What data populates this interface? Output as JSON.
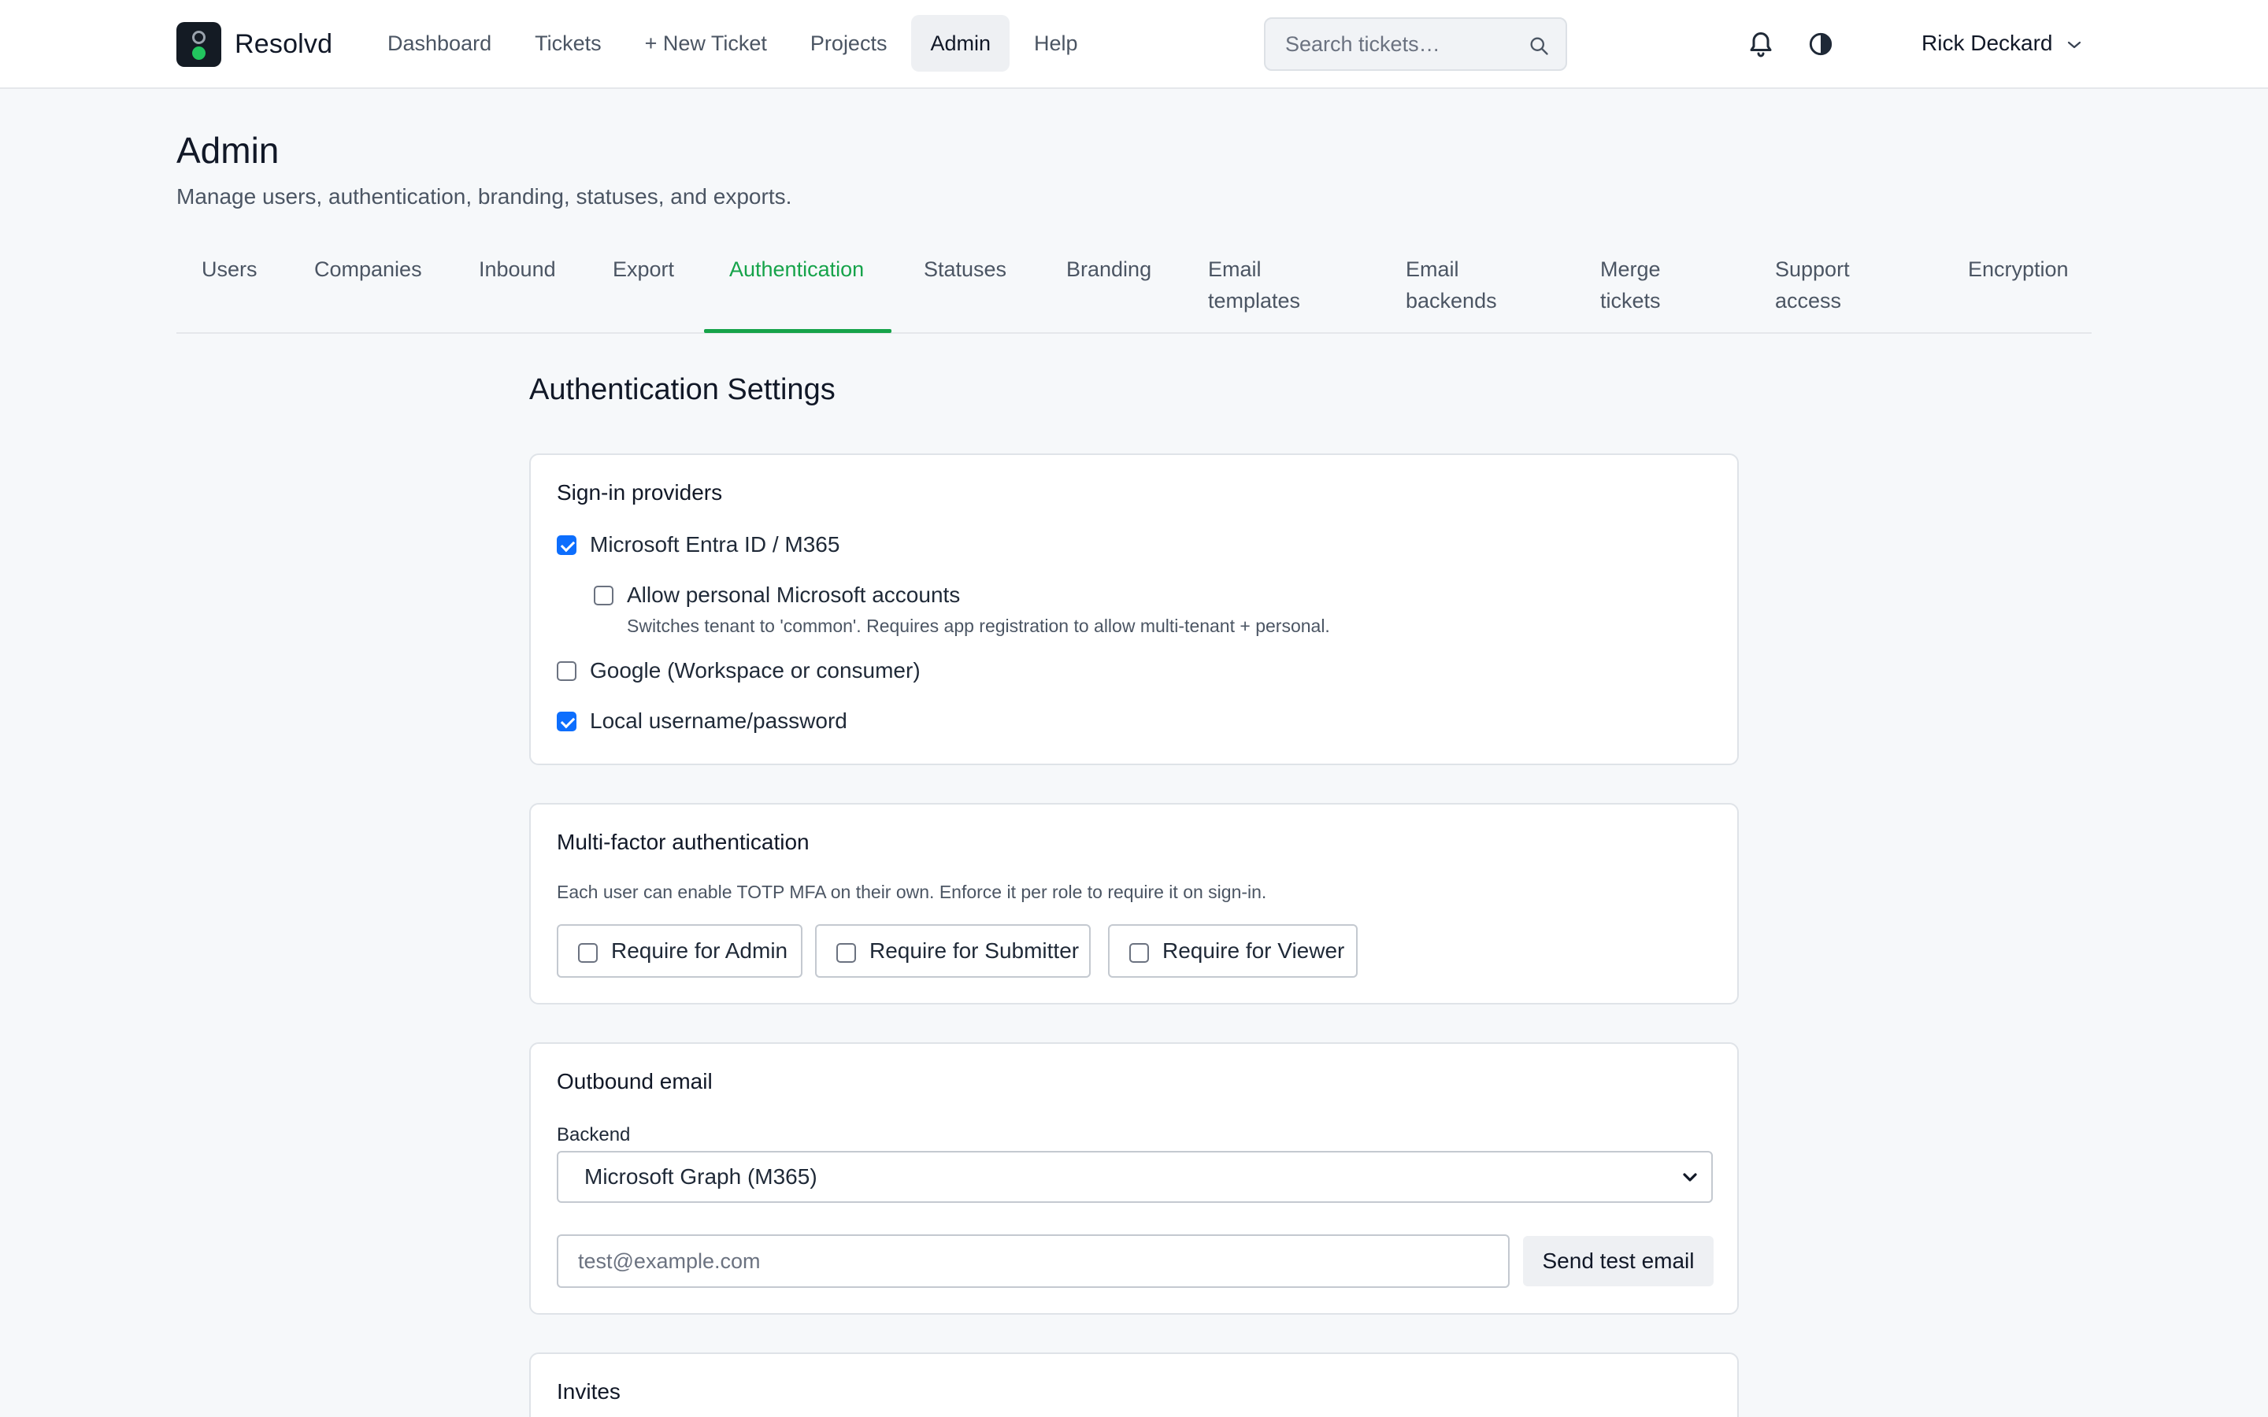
{
  "app": {
    "name": "Resolvd"
  },
  "nav": {
    "items": [
      {
        "label": "Dashboard"
      },
      {
        "label": "Tickets"
      },
      {
        "label": "+ New Ticket"
      },
      {
        "label": "Projects"
      },
      {
        "label": "Admin",
        "active": true
      },
      {
        "label": "Help"
      }
    ],
    "search_placeholder": "Search tickets…",
    "user_name": "Rick Deckard"
  },
  "page": {
    "title": "Admin",
    "subtitle": "Manage users, authentication, branding, statuses, and exports."
  },
  "tabs": [
    {
      "label": "Users"
    },
    {
      "label": "Companies"
    },
    {
      "label": "Inbound"
    },
    {
      "label": "Export"
    },
    {
      "label": "Authentication",
      "active": true
    },
    {
      "label": "Statuses"
    },
    {
      "label": "Branding"
    },
    {
      "label": "Email templates"
    },
    {
      "label": "Email backends"
    },
    {
      "label": "Merge tickets"
    },
    {
      "label": "Support access"
    },
    {
      "label": "Encryption"
    }
  ],
  "auth": {
    "section_title": "Authentication Settings",
    "signin": {
      "title": "Sign-in providers",
      "microsoft": {
        "label": "Microsoft Entra ID / M365",
        "checked": true
      },
      "personal_ms": {
        "label": "Allow personal Microsoft accounts",
        "checked": false,
        "hint": "Switches tenant to 'common'. Requires app registration to allow multi-tenant + personal."
      },
      "google": {
        "label": "Google (Workspace or consumer)",
        "checked": false
      },
      "local": {
        "label": "Local username/password",
        "checked": true
      }
    },
    "mfa": {
      "title": "Multi-factor authentication",
      "description": "Each user can enable TOTP MFA on their own. Enforce it per role to require it on sign-in.",
      "roles": [
        {
          "label": "Require for Admin",
          "checked": false
        },
        {
          "label": "Require for Submitter",
          "checked": false
        },
        {
          "label": "Require for Viewer",
          "checked": false
        }
      ]
    },
    "outbound": {
      "title": "Outbound email",
      "backend_label": "Backend",
      "backend_value": "Microsoft Graph (M365)",
      "test_placeholder": "test@example.com",
      "send_button": "Send test email"
    },
    "invites": {
      "title": "Invites"
    }
  },
  "colors": {
    "accent": "#16a34a",
    "checkbox": "#0d6efd",
    "logo_dot": "#22c55e"
  }
}
